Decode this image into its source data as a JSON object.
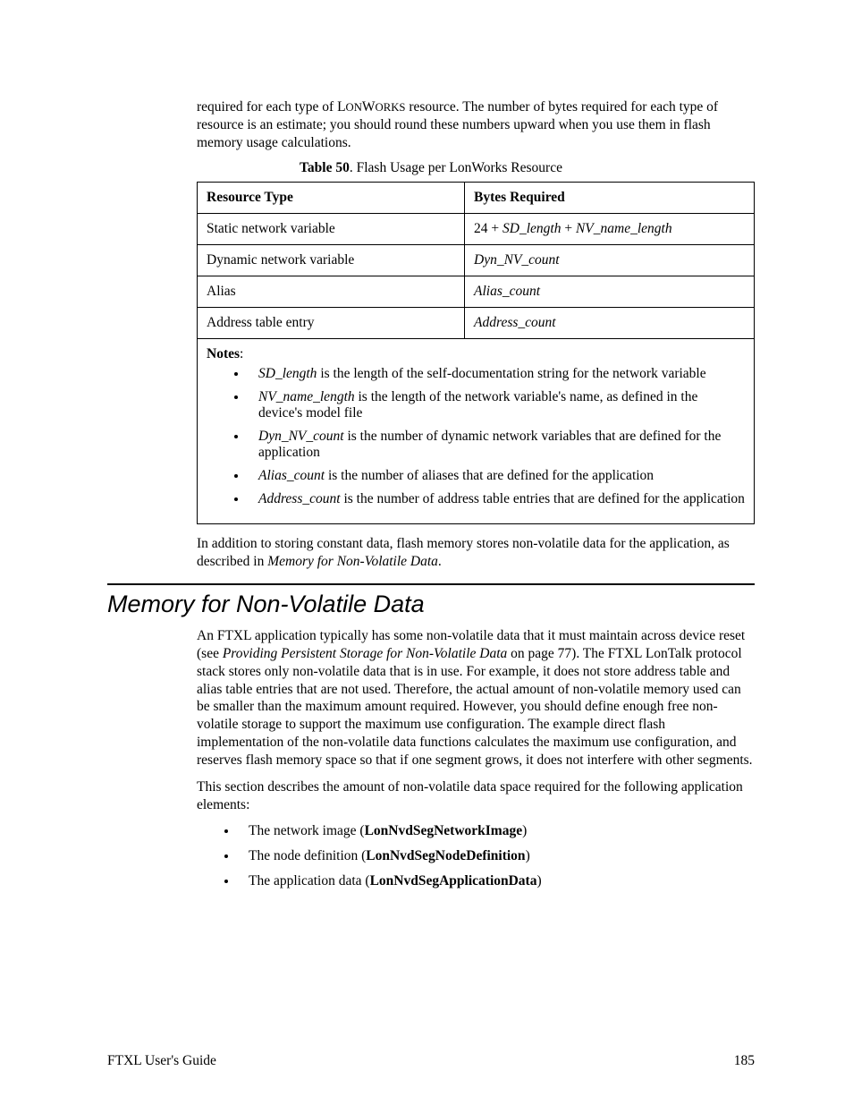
{
  "intro_para": {
    "pre": "required for each type of ",
    "smallcaps1": "L",
    "small1": "ON",
    "smallcaps2": "W",
    "small2": "ORKS",
    "post": " resource.  The number of bytes required for each type of resource is an estimate; you should round these numbers upward when you use them in flash memory usage calculations."
  },
  "table_caption": {
    "label": "Table 50",
    "rest": ". Flash Usage per LonWorks Resource"
  },
  "table": {
    "head": [
      "Resource Type",
      "Bytes Required"
    ],
    "rows": [
      {
        "c1": "Static network variable",
        "c2_pre": "24 + ",
        "c2_i1": "SD_length",
        "c2_mid": " + ",
        "c2_i2": "NV_name_length"
      },
      {
        "c1": "Dynamic network variable",
        "c2_i1": "Dyn_NV_count"
      },
      {
        "c1": "Alias",
        "c2_i1": "Alias_count"
      },
      {
        "c1": "Address table entry",
        "c2_i1": "Address_count"
      }
    ]
  },
  "notes": {
    "label": "Notes",
    "items": [
      {
        "term": "SD_length",
        "rest": " is the length of the self-documentation string for the network variable"
      },
      {
        "term": "NV_name_length",
        "rest": " is the length of the network variable's name, as defined in the device's model file"
      },
      {
        "term": "Dyn_NV_count",
        "rest": " is the number of dynamic network variables that are defined for the application"
      },
      {
        "term": "Alias_count",
        "rest": " is the number of aliases that are defined for the application"
      },
      {
        "term": "Address_count",
        "rest": " is the number of address table entries that are defined for the application"
      }
    ]
  },
  "addition_para": {
    "pre": "In addition to storing constant data, flash memory stores non-volatile data for the application, as described in ",
    "ref": "Memory for Non-Volatile Data",
    "post": "."
  },
  "heading": "Memory for Non-Volatile Data",
  "nv_para1": {
    "pre": "An FTXL application typically has some non-volatile data that it must maintain across device reset (see ",
    "ref": "Providing Persistent Storage for Non-Volatile Data",
    "post": " on page 77).  The FTXL LonTalk protocol stack stores only non-volatile data that is in use.  For example, it does not store address table and alias table entries that are not used.  Therefore, the actual amount of non-volatile memory used can be smaller than the maximum amount required.  However, you should define enough free non-volatile storage to support the maximum use configuration.  The example direct flash implementation of the non-volatile data functions calculates the maximum use configuration, and reserves flash memory space so that if one segment grows, it does not interfere with other segments."
  },
  "nv_para2": "This section describes the amount of non-volatile data space required for the following application elements:",
  "nv_list": [
    {
      "pre": "The network image (",
      "bold": "LonNvdSegNetworkImage",
      "post": ")"
    },
    {
      "pre": "The node definition (",
      "bold": "LonNvdSegNodeDefinition",
      "post": ")"
    },
    {
      "pre": "The application data (",
      "bold": "LonNvdSegApplicationData",
      "post": ")"
    }
  ],
  "footer": {
    "left": "FTXL User's Guide",
    "right": "185"
  }
}
